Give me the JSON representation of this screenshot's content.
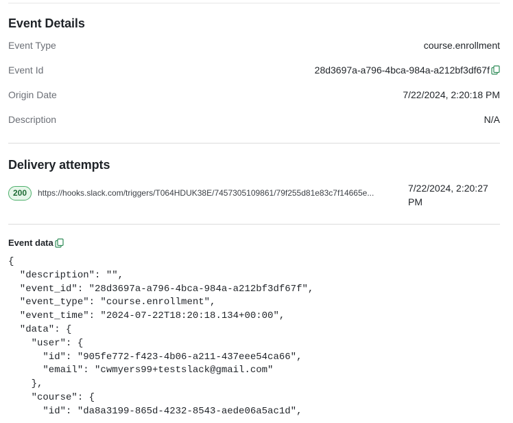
{
  "event_details": {
    "title": "Event Details",
    "fields": [
      {
        "label": "Event Type",
        "value": "course.enrollment"
      },
      {
        "label": "Event Id",
        "value": "28d3697a-a796-4bca-984a-a212bf3df67f"
      },
      {
        "label": "Origin Date",
        "value": "7/22/2024, 2:20:18 PM"
      },
      {
        "label": "Description",
        "value": "N/A"
      }
    ]
  },
  "delivery": {
    "title": "Delivery attempts",
    "attempts": [
      {
        "status": "200",
        "url": "https://hooks.slack.com/triggers/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...",
        "date_line1": "7/22/2024, 2:20:27",
        "date_line2": "PM",
        "status_color": "#4caf6a"
      }
    ]
  },
  "event_data": {
    "title": "Event data",
    "json_text": "{\n  \"description\": \"\",\n  \"event_id\": \"28d3697a-a796-4bca-984a-a212bf3df67f\",\n  \"event_type\": \"course.enrollment\",\n  \"event_time\": \"2024-07-22T18:20:18.134+00:00\",\n  \"data\": {\n    \"user\": {\n      \"id\": \"905fe772-f423-4b06-a211-437eee54ca66\",\n      \"email\": \"cwmyers99+testslack@gmail.com\"\n    },\n    \"course\": {\n      \"id\": \"da8a3199-865d-4232-8543-aede06a5ac1d\","
  },
  "icons": {
    "copy": "copy-icon"
  },
  "colors": {
    "accent_green": "#2e8b57"
  }
}
